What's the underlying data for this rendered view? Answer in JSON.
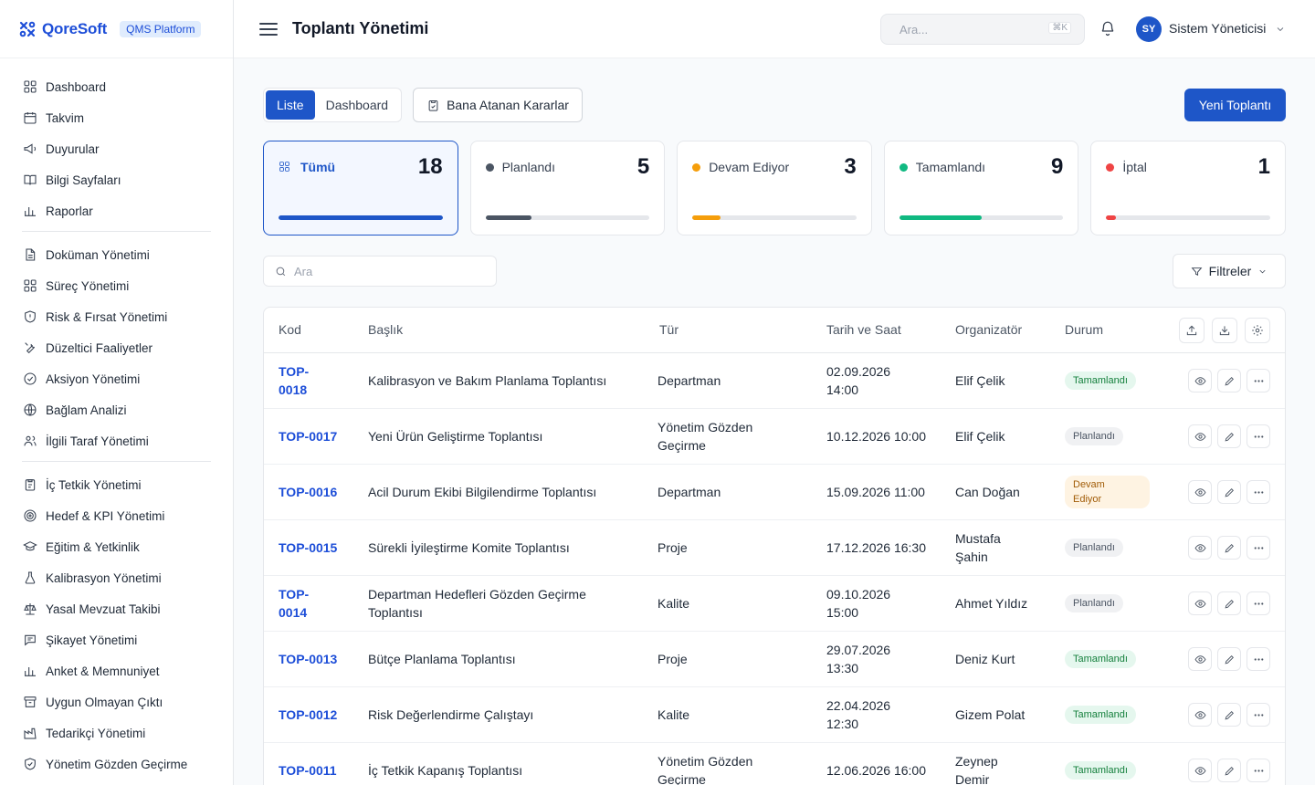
{
  "brand": {
    "name": "QoreSoft",
    "badge": "QMS Platform"
  },
  "sidebar": {
    "groups": [
      [
        {
          "label": "Dashboard",
          "icon": "dashboard-icon"
        },
        {
          "label": "Takvim",
          "icon": "calendar-icon"
        },
        {
          "label": "Duyurular",
          "icon": "megaphone-icon"
        },
        {
          "label": "Bilgi Sayfaları",
          "icon": "book-icon"
        },
        {
          "label": "Raporlar",
          "icon": "bar-chart-icon"
        }
      ],
      [
        {
          "label": "Doküman Yönetimi",
          "icon": "document-icon"
        },
        {
          "label": "Süreç Yönetimi",
          "icon": "process-icon"
        },
        {
          "label": "Risk & Fırsat Yönetimi",
          "icon": "shield-icon"
        },
        {
          "label": "Düzeltici Faaliyetler",
          "icon": "wrench-icon"
        },
        {
          "label": "Aksiyon Yönetimi",
          "icon": "check-circle-icon"
        },
        {
          "label": "Bağlam Analizi",
          "icon": "globe-icon"
        },
        {
          "label": "İlgili Taraf Yönetimi",
          "icon": "users-icon"
        }
      ],
      [
        {
          "label": "İç Tetkik Yönetimi",
          "icon": "clipboard-icon"
        },
        {
          "label": "Hedef & KPI Yönetimi",
          "icon": "target-icon"
        },
        {
          "label": "Eğitim & Yetkinlik",
          "icon": "graduation-cap-icon"
        },
        {
          "label": "Kalibrasyon Yönetimi",
          "icon": "flask-icon"
        },
        {
          "label": "Yasal Mevzuat Takibi",
          "icon": "scale-icon"
        },
        {
          "label": "Şikayet Yönetimi",
          "icon": "chat-icon"
        },
        {
          "label": "Anket & Memnuniyet",
          "icon": "poll-icon"
        },
        {
          "label": "Uygun Olmayan Çıktı",
          "icon": "archive-icon"
        },
        {
          "label": "Tedarikçi Yönetimi",
          "icon": "factory-icon"
        },
        {
          "label": "Yönetim Gözden Geçirme",
          "icon": "shield-check-icon"
        }
      ]
    ]
  },
  "header": {
    "title": "Toplantı Yönetimi",
    "search_placeholder": "Ara...",
    "shortcut": "⌘K",
    "user_initials": "SY",
    "user_name": "Sistem Yöneticisi"
  },
  "toolbar": {
    "view_list": "Liste",
    "view_dashboard": "Dashboard",
    "assigned_label": "Bana Atanan Kararlar",
    "new_label": "Yeni Toplantı"
  },
  "stats": [
    {
      "label": "Tümü",
      "count": "18",
      "color": "#1e56c8",
      "fraction": 1.0,
      "active": true
    },
    {
      "label": "Planlandı",
      "count": "5",
      "color": "#4b5563",
      "fraction": 0.28,
      "active": false
    },
    {
      "label": "Devam Ediyor",
      "count": "3",
      "color": "#f59e0b",
      "fraction": 0.17,
      "active": false
    },
    {
      "label": "Tamamlandı",
      "count": "9",
      "color": "#10b981",
      "fraction": 0.5,
      "active": false
    },
    {
      "label": "İptal",
      "count": "1",
      "color": "#ef4444",
      "fraction": 0.06,
      "active": false
    }
  ],
  "list": {
    "search_placeholder": "Ara",
    "filters_label": "Filtreler",
    "columns": [
      "Kod",
      "Başlık",
      "Tür",
      "Tarih ve Saat",
      "Organizatör",
      "Durum"
    ],
    "rows": [
      {
        "code": "TOP-\n0018",
        "title": "Kalibrasyon ve Bakım Planlama Toplantısı",
        "type": "Departman",
        "date": "02.09.2026\n14:00",
        "organizer": "Elif Çelik",
        "status": "Tamamlandı",
        "status_kind": "done"
      },
      {
        "code": "TOP-0017",
        "title": "Yeni Ürün Geliştirme Toplantısı",
        "type": "Yönetim Gözden\nGeçirme",
        "date": "10.12.2026 10:00",
        "organizer": "Elif Çelik",
        "status": "Planlandı",
        "status_kind": "plan"
      },
      {
        "code": "TOP-0016",
        "title": "Acil Durum Ekibi Bilgilendirme Toplantısı",
        "type": "Departman",
        "date": "15.09.2026 11:00",
        "organizer": "Can Doğan",
        "status": "Devam\nEdiyor",
        "status_kind": "prog"
      },
      {
        "code": "TOP-0015",
        "title": "Sürekli İyileştirme Komite Toplantısı",
        "type": "Proje",
        "date": "17.12.2026 16:30",
        "organizer": "Mustafa\nŞahin",
        "status": "Planlandı",
        "status_kind": "plan"
      },
      {
        "code": "TOP-\n0014",
        "title": "Departman Hedefleri Gözden Geçirme\nToplantısı",
        "type": "Kalite",
        "date": "09.10.2026\n15:00",
        "organizer": "Ahmet Yıldız",
        "status": "Planlandı",
        "status_kind": "plan"
      },
      {
        "code": "TOP-0013",
        "title": "Bütçe Planlama Toplantısı",
        "type": "Proje",
        "date": "29.07.2026\n13:30",
        "organizer": "Deniz Kurt",
        "status": "Tamamlandı",
        "status_kind": "done"
      },
      {
        "code": "TOP-0012",
        "title": "Risk Değerlendirme Çalıştayı",
        "type": "Kalite",
        "date": "22.04.2026\n12:30",
        "organizer": "Gizem Polat",
        "status": "Tamamlandı",
        "status_kind": "done"
      },
      {
        "code": "TOP-0011",
        "title": "İç Tetkik Kapanış Toplantısı",
        "type": "Yönetim Gözden\nGeçirme",
        "date": "12.06.2026 16:00",
        "organizer": "Zeynep\nDemir",
        "status": "Tamamlandı",
        "status_kind": "done"
      }
    ]
  }
}
